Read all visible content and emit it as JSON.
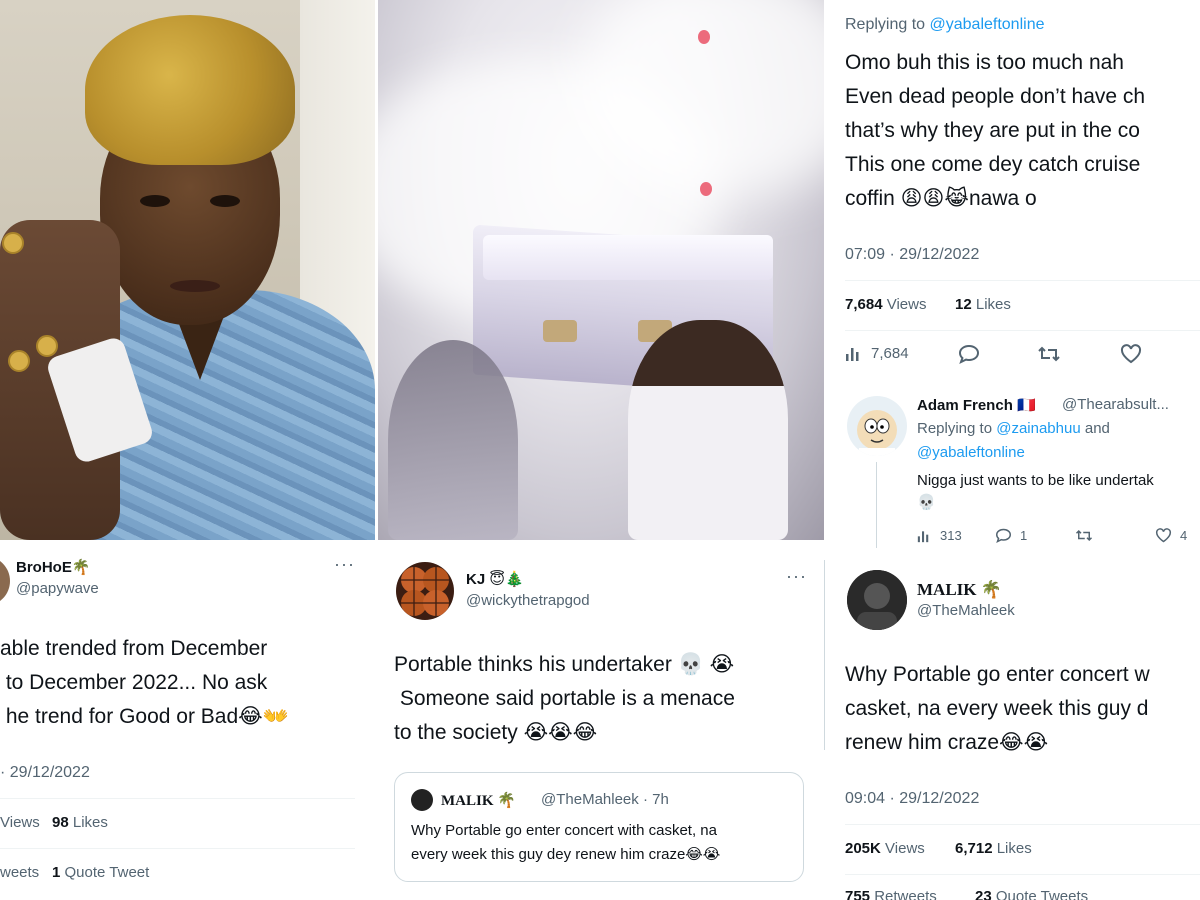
{
  "top_right_tweet": {
    "replying_prefix": "Replying to",
    "replying_handle": "@yabaleftonline",
    "body": "Omo buh this is too much nah\nEven dead people don’t have ch\nthat’s why they are put in the co\nThis one come dey catch cruise\ncoffin 😩😩😹nawa o",
    "timestamp": "07:09 · 29/12/2022",
    "views_count": "7,684",
    "views_label": "Views",
    "likes_count": "12",
    "likes_label": "Likes",
    "action_views": "7,684"
  },
  "adam_reply": {
    "name": "Adam French 🇫🇷",
    "handle": "@Thearabsult...",
    "replying_prefix": "Replying to",
    "replying_handle_1": "@zainabhuu",
    "replying_and": "and",
    "replying_handle_2": "@yabaleftonline",
    "body": "Nigga just wants to be like undertak\n💀",
    "views": "313",
    "replies": "1",
    "likes": "4"
  },
  "brohoe_tweet": {
    "name": "BroHoE🌴",
    "handle": "@papywave",
    "body": "able trended from December\n to December 2022... No ask\n he trend for Good or Bad😂👐",
    "timestamp": "· 29/12/2022",
    "views_label": "Views",
    "likes_count": "98",
    "likes_label": "Likes",
    "retweets_label": "weets",
    "quote_count": "1",
    "quote_label": "Quote Tweet"
  },
  "kj_tweet": {
    "name": "KJ 😇🎄",
    "handle": "@wickythetrapgod",
    "body": "Portable thinks his undertaker 💀 😭\n Someone said portable is a menace\nto the society 😭😭😂",
    "quote": {
      "name": "MALIK 🌴",
      "handle": "@TheMahleek · 7h",
      "body": "Why Portable go enter concert with casket, na\nevery week this guy dey renew him craze😂😭"
    }
  },
  "malik_tweet": {
    "name": "MALIK 🌴",
    "handle": "@TheMahleek",
    "body": "Why Portable go enter concert w\ncasket, na every week this guy d\nrenew him craze😂😭",
    "timestamp": "09:04 · 29/12/2022",
    "views_count": "205K",
    "views_label": "Views",
    "likes_count": "6,712",
    "likes_label": "Likes",
    "retweets_count": "755",
    "retweets_label": "Retweets",
    "quotes_count": "23",
    "quotes_label": "Quote Tweets"
  },
  "colors": {
    "link": "#1d9bf0",
    "muted": "#536471",
    "text": "#0f1419"
  }
}
